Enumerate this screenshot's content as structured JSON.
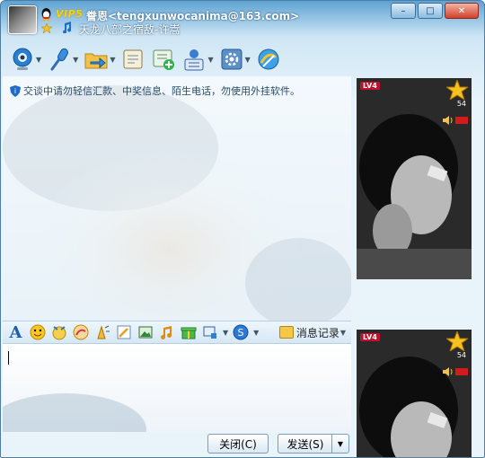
{
  "title": {
    "vip_label": "VIP5",
    "contact": "誊恩<tengxunwocanima@163.com>",
    "signature": "天龙八部之宿敌-许嵩"
  },
  "window_buttons": {
    "minimize": "–",
    "maximize": "□",
    "close": "✕"
  },
  "toolbar": [
    {
      "icon": "webcam-icon"
    },
    {
      "icon": "microphone-icon"
    },
    {
      "icon": "folder-transfer-icon"
    },
    {
      "icon": "sms-icon"
    },
    {
      "icon": "add-friend-icon"
    },
    {
      "icon": "profile-card-icon"
    },
    {
      "icon": "settings-icon"
    },
    {
      "icon": "app-icon"
    }
  ],
  "notice": "交谈中请勿轻信汇款、中奖信息、陌生电话，勿使用外挂软件。",
  "format_bar": {
    "font_label": "A",
    "message_history": "消息记录"
  },
  "buttons": {
    "close": "关闭(C)",
    "send": "发送(S)"
  },
  "side_panel": {
    "level_badge": "LV4",
    "level_number": "54"
  },
  "colors": {
    "title_bar": "#5fa3d3",
    "panel": "#e8f3fa",
    "accent": "#1d5fae"
  }
}
